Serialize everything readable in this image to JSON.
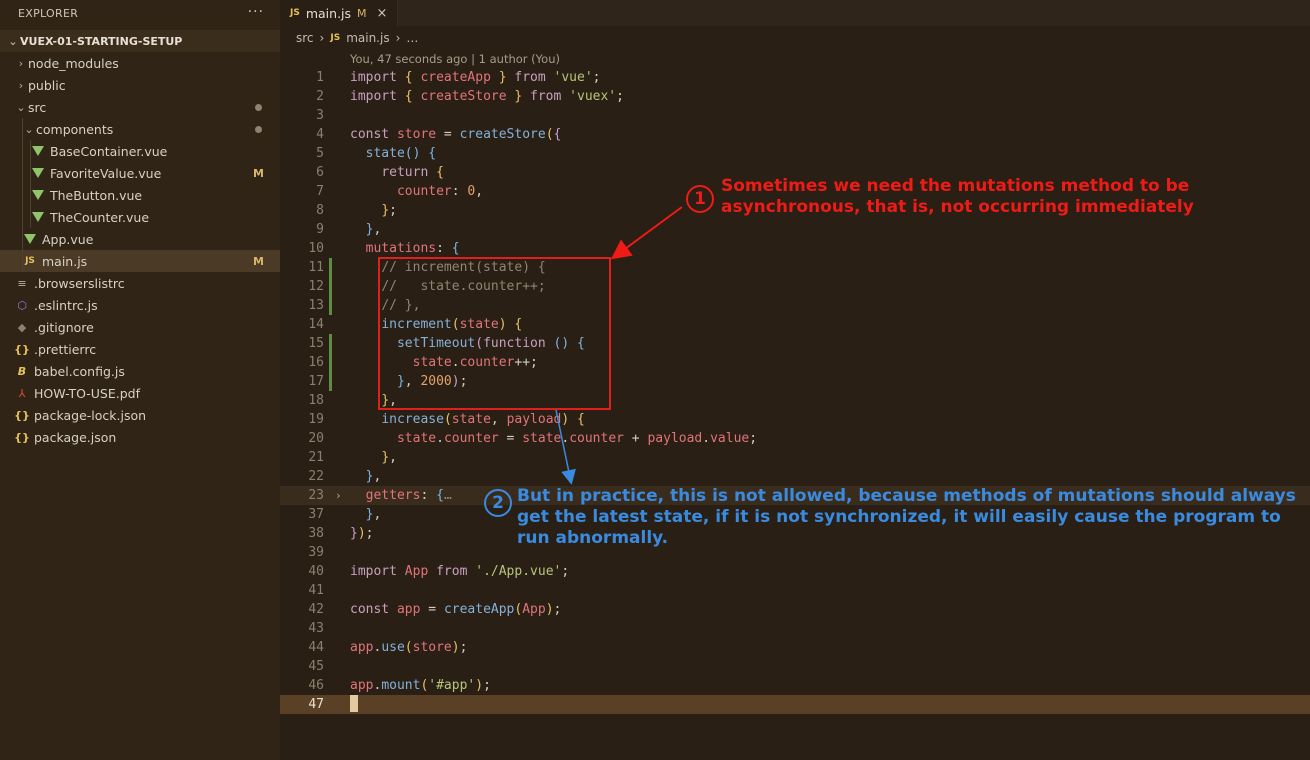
{
  "explorer": {
    "title": "EXPLORER",
    "more": "···",
    "project": "VUEX-01-STARTING-SETUP",
    "items": [
      {
        "label": "node_modules",
        "kind": "folder",
        "depth": 0,
        "open": false
      },
      {
        "label": "public",
        "kind": "folder",
        "depth": 0,
        "open": false
      },
      {
        "label": "src",
        "kind": "folder",
        "depth": 0,
        "open": true,
        "dot": true
      },
      {
        "label": "components",
        "kind": "folder",
        "depth": 1,
        "open": true,
        "dot": true
      },
      {
        "label": "BaseContainer.vue",
        "kind": "vue",
        "depth": 2
      },
      {
        "label": "FavoriteValue.vue",
        "kind": "vue",
        "depth": 2,
        "badge": "M"
      },
      {
        "label": "TheButton.vue",
        "kind": "vue",
        "depth": 2
      },
      {
        "label": "TheCounter.vue",
        "kind": "vue",
        "depth": 2
      },
      {
        "label": "App.vue",
        "kind": "vue",
        "depth": 1
      },
      {
        "label": "main.js",
        "kind": "js",
        "depth": 1,
        "badge": "M",
        "selected": true
      },
      {
        "label": ".browserslistrc",
        "kind": "lines",
        "depth": 0
      },
      {
        "label": ".eslintrc.js",
        "kind": "eslint",
        "depth": 0
      },
      {
        "label": ".gitignore",
        "kind": "git",
        "depth": 0
      },
      {
        "label": ".prettierrc",
        "kind": "braces",
        "depth": 0
      },
      {
        "label": "babel.config.js",
        "kind": "babel",
        "depth": 0
      },
      {
        "label": "HOW-TO-USE.pdf",
        "kind": "pdf",
        "depth": 0
      },
      {
        "label": "package-lock.json",
        "kind": "braces",
        "depth": 0
      },
      {
        "label": "package.json",
        "kind": "braces",
        "depth": 0
      }
    ]
  },
  "tab": {
    "icon": "JS",
    "label": "main.js",
    "badge": "M",
    "close": "×"
  },
  "breadcrumb": {
    "parts": [
      "src",
      "main.js",
      "…"
    ],
    "icon": "JS"
  },
  "blame": "You, 47 seconds ago | 1 author (You)",
  "code_lines": [
    {
      "n": "1",
      "html": "<span class='kw'>import</span> <span class='br1'>{</span> <span class='var'>createApp</span> <span class='br1'>}</span> <span class='kw'>from</span> <span class='str'>'vue'</span>;"
    },
    {
      "n": "2",
      "html": "<span class='kw'>import</span> <span class='br1'>{</span> <span class='var'>createStore</span> <span class='br1'>}</span> <span class='kw'>from</span> <span class='str'>'vuex'</span>;"
    },
    {
      "n": "3",
      "html": ""
    },
    {
      "n": "4",
      "html": "<span class='kw'>const</span> <span class='var'>store</span> = <span class='fn'>createStore</span><span class='br1'>(</span><span class='br2'>{</span>"
    },
    {
      "n": "5",
      "html": "  <span class='fn'>state</span><span class='br3'>()</span> <span class='br3'>{</span>"
    },
    {
      "n": "6",
      "html": "    <span class='kw'>return</span> <span class='br1'>{</span>"
    },
    {
      "n": "7",
      "html": "      <span class='prop'>counter</span>: <span class='num'>0</span>,"
    },
    {
      "n": "8",
      "html": "    <span class='br1'>}</span>;"
    },
    {
      "n": "9",
      "html": "  <span class='br3'>}</span>,"
    },
    {
      "n": "10",
      "html": "  <span class='prop'>mutations</span>: <span class='br3'>{</span>"
    },
    {
      "n": "11",
      "html": "    <span class='cm'>// increment(state) {</span>",
      "mark": true
    },
    {
      "n": "12",
      "html": "    <span class='cm'>//   state.counter++;</span>",
      "mark": true
    },
    {
      "n": "13",
      "html": "    <span class='cm'>// },</span>",
      "mark": true
    },
    {
      "n": "14",
      "html": "    <span class='fn'>increment</span><span class='br1'>(</span><span class='var'>state</span><span class='br1'>)</span> <span class='br1'>{</span>"
    },
    {
      "n": "15",
      "html": "      <span class='fn'>setTimeout</span><span class='br2'>(</span><span class='kw'>function</span> <span class='br3'>()</span> <span class='br3'>{</span>",
      "mark": true
    },
    {
      "n": "16",
      "html": "        <span class='var'>state</span>.<span class='prop'>counter</span>++;",
      "mark": true
    },
    {
      "n": "17",
      "html": "      <span class='br3'>}</span>, <span class='num'>2000</span><span class='br2'>)</span>;",
      "mark": true
    },
    {
      "n": "18",
      "html": "    <span class='br1'>}</span>,"
    },
    {
      "n": "19",
      "html": "    <span class='fn'>increase</span><span class='br1'>(</span><span class='var'>state</span>, <span class='var'>payload</span><span class='br1'>)</span> <span class='br1'>{</span>"
    },
    {
      "n": "20",
      "html": "      <span class='var'>state</span>.<span class='prop'>counter</span> = <span class='var'>state</span>.<span class='prop'>counter</span> + <span class='var'>payload</span>.<span class='prop'>value</span>;"
    },
    {
      "n": "21",
      "html": "    <span class='br1'>}</span>,"
    },
    {
      "n": "22",
      "html": "  <span class='br3'>}</span>,"
    },
    {
      "n": "23",
      "html": "  <span class='prop'>getters</span>: <span class='br3'>{</span><span class='cm'>…</span>",
      "fold": "›",
      "folded": true
    },
    {
      "n": "37",
      "html": "  <span class='br3'>}</span>,"
    },
    {
      "n": "38",
      "html": "<span class='br2'>}</span><span class='br1'>)</span>;"
    },
    {
      "n": "39",
      "html": ""
    },
    {
      "n": "40",
      "html": "<span class='kw'>import</span> <span class='var'>App</span> <span class='kw'>from</span> <span class='str'>'./App.vue'</span>;"
    },
    {
      "n": "41",
      "html": ""
    },
    {
      "n": "42",
      "html": "<span class='kw'>const</span> <span class='var'>app</span> = <span class='fn'>createApp</span><span class='br1'>(</span><span class='var'>App</span><span class='br1'>)</span>;"
    },
    {
      "n": "43",
      "html": ""
    },
    {
      "n": "44",
      "html": "<span class='var'>app</span>.<span class='fn'>use</span><span class='br1'>(</span><span class='var'>store</span><span class='br1'>)</span>;"
    },
    {
      "n": "45",
      "html": ""
    },
    {
      "n": "46",
      "html": "<span class='var'>app</span>.<span class='fn'>mount</span><span class='br1'>(</span><span class='str'>'#app'</span><span class='br1'>)</span>;"
    },
    {
      "n": "47",
      "html": "<span class='cursor-block'></span>",
      "current": true
    }
  ],
  "annotations": {
    "one": {
      "num": "1",
      "text": "Sometimes we need the mutations method to be asynchronous, that is, not occurring immediately"
    },
    "two": {
      "num": "2",
      "text": "But in practice, this is not allowed, because methods of mutations should always get the latest state, if it is not synchronized, it will easily cause the program to run abnormally."
    },
    "colors": {
      "red": "#ee1b16",
      "blue": "#3a8be0"
    }
  }
}
